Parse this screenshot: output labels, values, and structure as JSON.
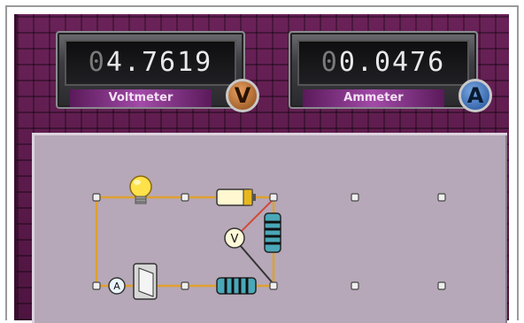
{
  "voltmeter": {
    "leading_digit": "0",
    "reading": "4.7619",
    "label": "Voltmeter",
    "badge": "V"
  },
  "ammeter": {
    "leading_digit": "0",
    "reading": "0.0476",
    "label": "Ammeter",
    "badge": "A"
  },
  "circuit": {
    "inline_voltmeter_symbol": "V",
    "inline_ammeter_symbol": "A"
  },
  "colors": {
    "background_wall": "#5a1848",
    "board": "#b6a8b8",
    "wire": "#e0a030"
  }
}
